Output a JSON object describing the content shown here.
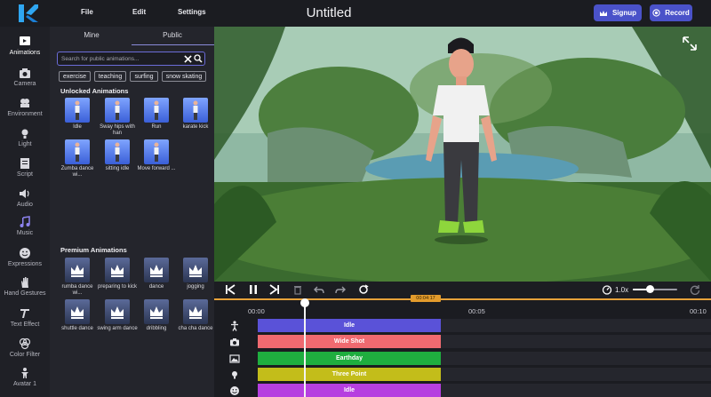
{
  "app": {
    "title": "Untitled",
    "menu": [
      "File",
      "Edit",
      "Settings"
    ],
    "signup_label": "Signup",
    "record_label": "Record",
    "accent": "#4a52c9"
  },
  "rail": {
    "items": [
      {
        "label": "Animations",
        "icon": "animations-icon"
      },
      {
        "label": "Camera",
        "icon": "camera-icon"
      },
      {
        "label": "Environment",
        "icon": "environment-icon"
      },
      {
        "label": "Light",
        "icon": "light-icon"
      },
      {
        "label": "Script",
        "icon": "script-icon"
      },
      {
        "label": "Audio",
        "icon": "audio-icon"
      },
      {
        "label": "Music",
        "icon": "music-icon"
      },
      {
        "label": "Expressions",
        "icon": "expressions-icon"
      },
      {
        "label": "Hand Gestures",
        "icon": "hand-gestures-icon"
      },
      {
        "label": "Text Effect",
        "icon": "text-effect-icon"
      },
      {
        "label": "Color Filter",
        "icon": "color-filter-icon"
      },
      {
        "label": "Avatar 1",
        "icon": "avatar-icon"
      }
    ]
  },
  "panel": {
    "tabs": [
      "Mine",
      "Public"
    ],
    "search_placeholder": "Search for public animations...",
    "chips": [
      "exercise",
      "teaching",
      "surfing",
      "snow skating"
    ],
    "unlocked_title": "Unlocked Animations",
    "unlocked": [
      "Idle",
      "Sway hips with han",
      "Run",
      "karate kick",
      "Zumba dance wi...",
      "sitting idle",
      "Move forward ..."
    ],
    "premium_title": "Premium Animations",
    "premium": [
      "rumba dance wi...",
      "preparing to kick",
      "dance",
      "jogging",
      "shuttle dance",
      "swing arm dance",
      "dribbling",
      "cha cha dance"
    ]
  },
  "playback": {
    "speed": "1.0x"
  },
  "timeline": {
    "ticks": [
      "00:00",
      "00:05",
      "00:10"
    ],
    "current_time": "00:04:17",
    "tracks": [
      {
        "label": "Idle",
        "color": "#5a52d8",
        "icon": "person-icon"
      },
      {
        "label": "Wide Shot",
        "color": "#f06a70",
        "icon": "camera-icon"
      },
      {
        "label": "Earthday",
        "color": "#1fae3f",
        "icon": "environment-icon"
      },
      {
        "label": "Three Point",
        "color": "#c3bd1a",
        "icon": "light-icon"
      },
      {
        "label": "Idle",
        "color": "#b63fe0",
        "icon": "face-icon"
      }
    ]
  }
}
